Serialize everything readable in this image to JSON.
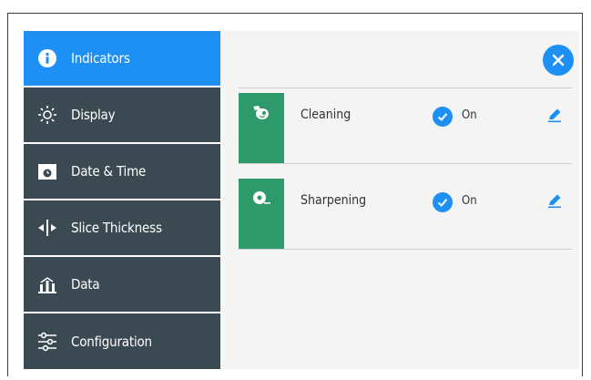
{
  "sidebar": {
    "items": [
      {
        "label": "Indicators",
        "icon": "info-icon",
        "active": true
      },
      {
        "label": "Display",
        "icon": "brightness-icon",
        "active": false
      },
      {
        "label": "Date & Time",
        "icon": "calendar-clock-icon",
        "active": false
      },
      {
        "label": "Slice Thickness",
        "icon": "slice-thickness-icon",
        "active": false
      },
      {
        "label": "Data",
        "icon": "data-chart-icon",
        "active": false
      },
      {
        "label": "Configuration",
        "icon": "sliders-icon",
        "active": false
      }
    ]
  },
  "indicators": [
    {
      "name": "Cleaning",
      "status": "On",
      "icon": "cleaning-icon"
    },
    {
      "name": "Sharpening",
      "status": "On",
      "icon": "sharpening-icon"
    }
  ],
  "colors": {
    "accent": "#1e90f5",
    "sidebar_bg": "#3b4a52",
    "tile_green": "#2e9a6b",
    "content_bg": "#f4f4f4"
  },
  "close_icon": "close-icon",
  "edit_icon": "pencil-icon",
  "check_icon": "check-circle-icon"
}
